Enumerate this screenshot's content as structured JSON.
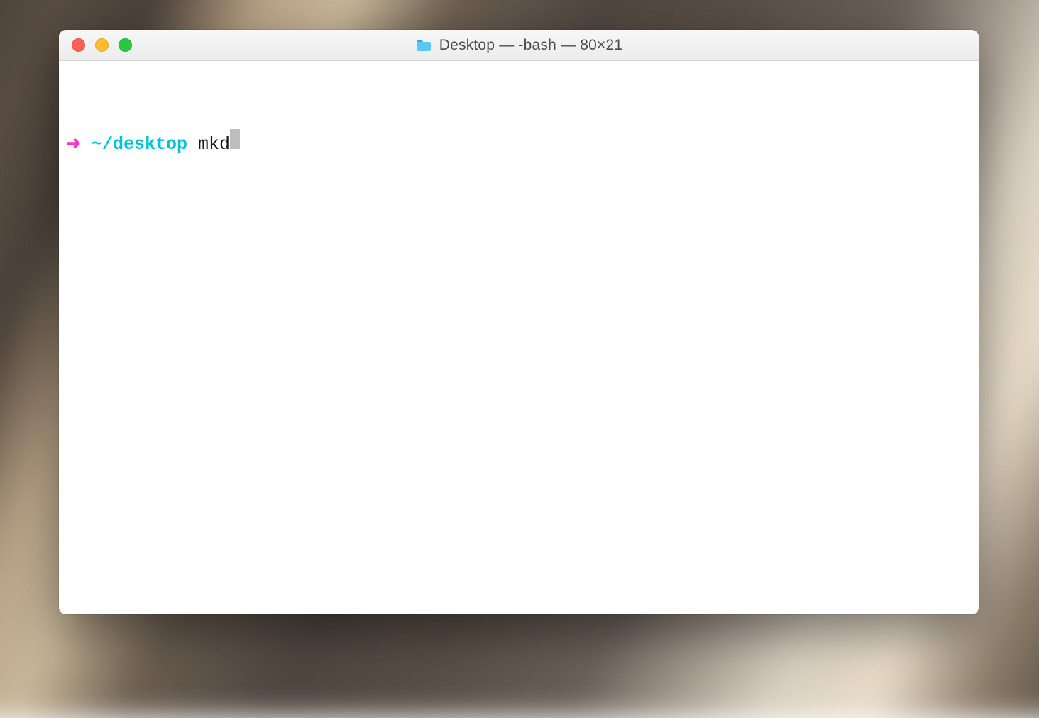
{
  "window": {
    "title": "Desktop — -bash — 80×21"
  },
  "terminal": {
    "prompt_arrow": "➜",
    "prompt_path": "~/desktop",
    "command_input": "mkd"
  },
  "colors": {
    "arrow": "#ff33cc",
    "path": "#00c4d6",
    "cursor": "#bdbdbd",
    "close": "#ff5f57",
    "minimize": "#ffbd2e",
    "maximize": "#28c940"
  }
}
